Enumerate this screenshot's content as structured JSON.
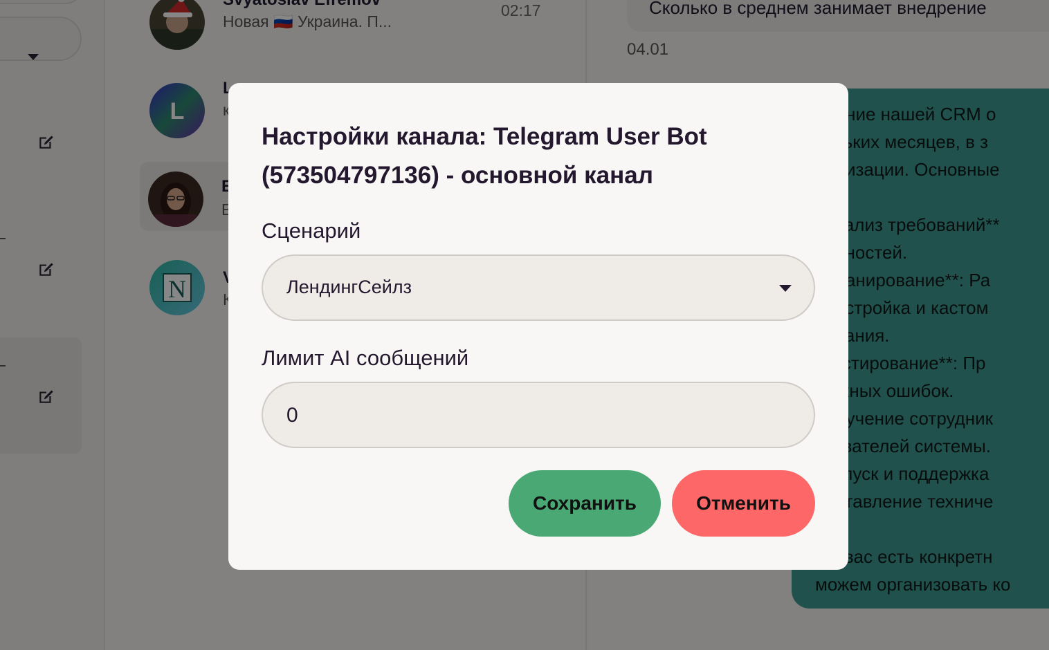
{
  "colors": {
    "save_button": "#4aa874",
    "cancel_button": "#fd6767",
    "outgoing_bubble": "#3e9a90",
    "modal_background": "#f9f7f5"
  },
  "chat_list": {
    "items": [
      {
        "name": "Svyatoslav Efremov",
        "preview": "Новая 🇷🇺 Украина. П...",
        "time": "02:17",
        "avatar_icon": "user-photo-santa-hat"
      },
      {
        "name": "L",
        "preview": "к",
        "avatar_letter": "L",
        "avatar_icon": "letter-avatar"
      },
      {
        "name": "E",
        "preview": "E",
        "avatar_icon": "user-photo"
      },
      {
        "name": "V",
        "preview": "К",
        "avatar_letter": "N",
        "avatar_icon": "notion-style-logo"
      }
    ]
  },
  "conversation": {
    "incoming_message": "Сколько в среднем занимает внедрение",
    "incoming_date": "04.01",
    "outgoing_lines": [
      "дрение нашей CRM о",
      "кольких месяцев, в з",
      "томизации. Основные",
      "",
      "*Анализ требований**",
      "ребностей.",
      "*Планирование**: Ра",
      "*Настройка и кастом",
      "бования.",
      "*Тестирование**: Пр",
      "можных ошибок.",
      "*Обучение сотрудник",
      "ьзователей системы.",
      "*Запуск и поддержка",
      "доставление техниче",
      "",
      "и у вас есть конкретн",
      "можем организовать ко"
    ]
  },
  "modal": {
    "title": "Настройки канала: Telegram User Bot (573504797136) - основной канал",
    "scenario_label": "Сценарий",
    "scenario_value": "ЛендингСейлз",
    "limit_label": "Лимит AI сообщений",
    "limit_value": "0",
    "save_label": "Сохранить",
    "cancel_label": "Отменить"
  }
}
